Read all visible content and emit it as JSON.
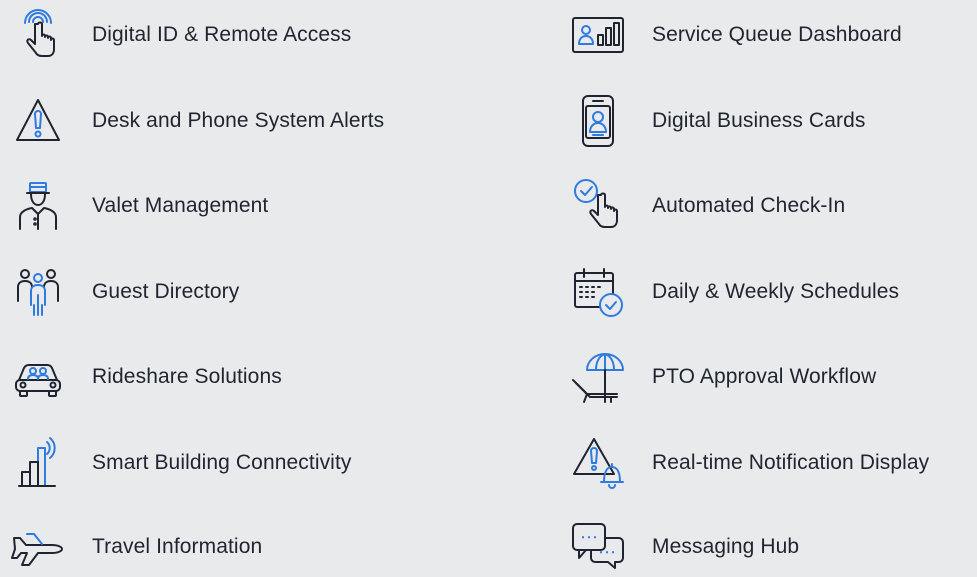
{
  "colors": {
    "background": "#e9eaeb",
    "text": "#1f2430",
    "accent": "#2f7be0"
  },
  "left_column": [
    {
      "label": "Digital ID & Remote Access",
      "icon": "touch-id-icon"
    },
    {
      "label": "Desk and Phone System Alerts",
      "icon": "alert-triangle-icon"
    },
    {
      "label": "Valet Management",
      "icon": "valet-icon"
    },
    {
      "label": "Guest Directory",
      "icon": "guest-directory-icon"
    },
    {
      "label": "Rideshare Solutions",
      "icon": "rideshare-car-icon"
    },
    {
      "label": "Smart Building Connectivity",
      "icon": "smart-building-icon"
    },
    {
      "label": "Travel Information",
      "icon": "airplane-icon"
    }
  ],
  "right_column": [
    {
      "label": "Service Queue Dashboard",
      "icon": "dashboard-icon"
    },
    {
      "label": "Digital Business Cards",
      "icon": "business-card-phone-icon"
    },
    {
      "label": "Automated Check-In",
      "icon": "check-in-tap-icon"
    },
    {
      "label": "Daily & Weekly Schedules",
      "icon": "calendar-check-icon"
    },
    {
      "label": "PTO Approval Workflow",
      "icon": "beach-umbrella-icon"
    },
    {
      "label": "Real-time Notification Display",
      "icon": "alert-bell-icon"
    },
    {
      "label": "Messaging Hub",
      "icon": "chat-bubbles-icon"
    }
  ]
}
